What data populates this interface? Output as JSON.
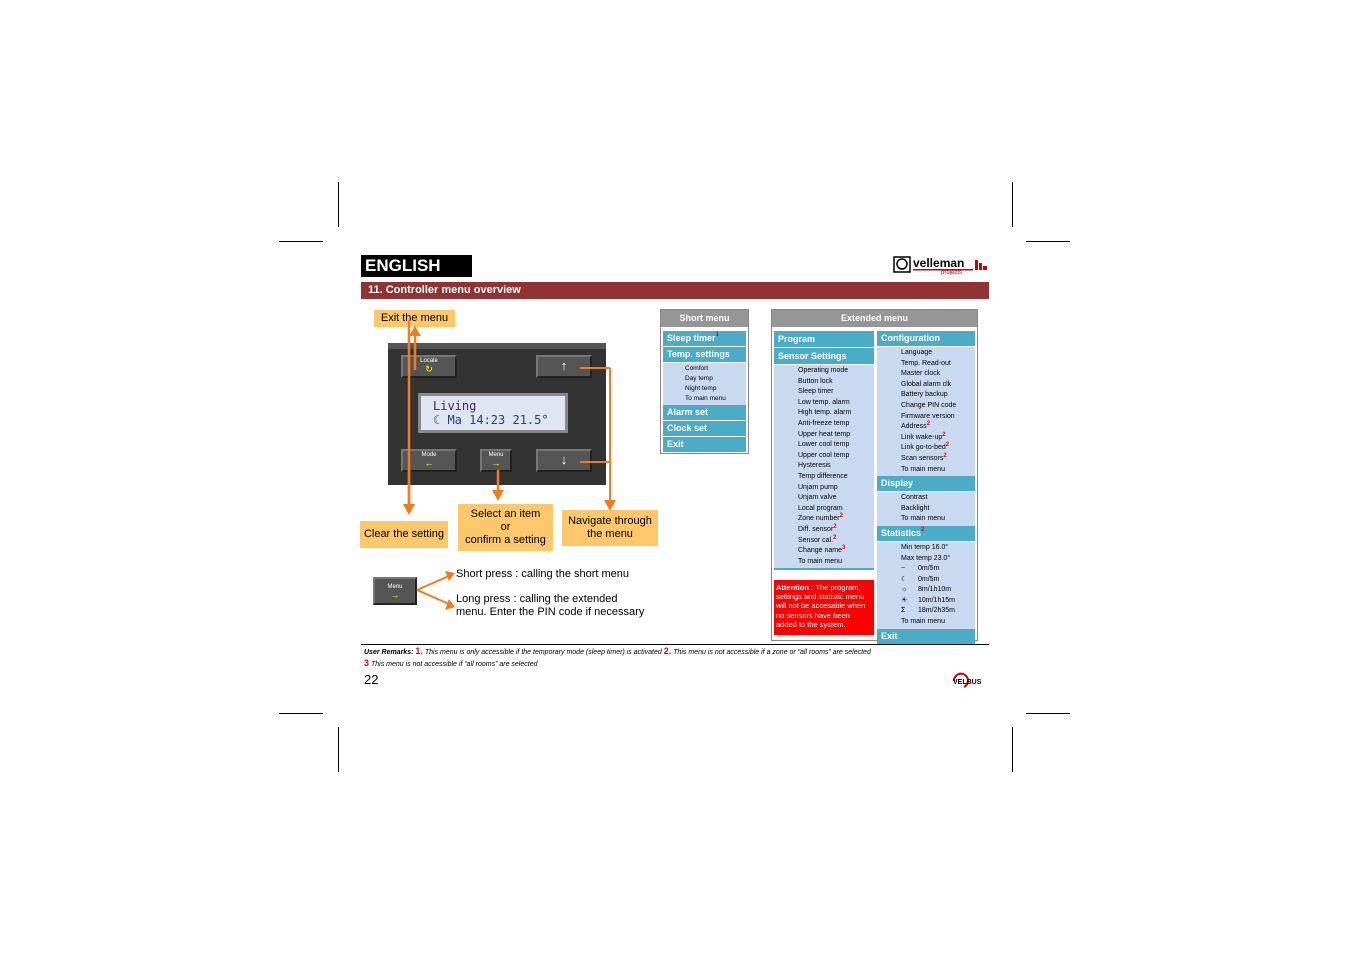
{
  "header": {
    "language": "ENGLISH",
    "logo_text": "velleman projects",
    "section_title": "11. Controller menu overview"
  },
  "device": {
    "buttons": {
      "locale": {
        "label": "Locale",
        "glyph": "↻"
      },
      "up": {
        "glyph": "↑"
      },
      "mode": {
        "label": "Mode",
        "glyph": "←"
      },
      "menu": {
        "label": "Menu",
        "glyph": "→"
      },
      "down": {
        "glyph": "↓"
      }
    },
    "lcd": {
      "line1": "Living",
      "line2": "☾  Ma 14:23 21.5°"
    }
  },
  "callouts": {
    "exit": "Exit the menu",
    "clear": "Clear the setting",
    "select_line1": "Select an item",
    "select_line2": "or",
    "select_line3": "confirm a setting",
    "navigate_line1": "Navigate through",
    "navigate_line2": "the menu"
  },
  "menu_press": {
    "button_label": "Menu",
    "button_glyph": "→",
    "short_press": "Short press : calling the short menu",
    "long_press_line1": "Long press : calling the extended",
    "long_press_line2": "menu. Enter the PIN code if necessary"
  },
  "short_menu": {
    "title": "Short menu",
    "items": [
      {
        "label": "Sleep timer",
        "note": "1"
      },
      {
        "label": "Temp. settings",
        "sub": [
          "Comfort",
          "Day temp",
          "Night temp",
          "To main menu"
        ]
      },
      {
        "label": "Alarm set"
      },
      {
        "label": "Clock set"
      },
      {
        "label": "Exit"
      }
    ]
  },
  "extended_menu": {
    "title": "Extended menu",
    "program": "Program",
    "sensor_settings": {
      "label": "Sensor Settings",
      "items": [
        {
          "label": "Operating mode"
        },
        {
          "label": "Button lock"
        },
        {
          "label": "Sleep timer"
        },
        {
          "label": "Low temp. alarm"
        },
        {
          "label": "High temp. alarm"
        },
        {
          "label": "Anti-freeze temp"
        },
        {
          "label": "Upper heat temp"
        },
        {
          "label": "Lower cool temp"
        },
        {
          "label": "Upper cool temp"
        },
        {
          "label": "Hysteresis"
        },
        {
          "label": "Temp difference"
        },
        {
          "label": "Unjam pump"
        },
        {
          "label": "Unjam valve"
        },
        {
          "label": "Local program"
        },
        {
          "label": "Zone number",
          "note": "2"
        },
        {
          "label": "Diff. sensor",
          "note": "2"
        },
        {
          "label": "Sensor cal.",
          "note": "2"
        },
        {
          "label": "Change name",
          "note": "3"
        },
        {
          "label": "To main menu"
        }
      ]
    },
    "attention_label": "Attention :",
    "attention_text": "The program, settings and statistic menu will not be accesable when no sensors have been added to the system.",
    "configuration": {
      "label": "Configuration",
      "items": [
        {
          "label": "Language"
        },
        {
          "label": "Temp. Read-out"
        },
        {
          "label": "Master clock"
        },
        {
          "label": "Global alarm clk"
        },
        {
          "label": "Battery backup"
        },
        {
          "label": "Change PIN code"
        },
        {
          "label": "Firmware version"
        },
        {
          "label": "Address",
          "note": "2"
        },
        {
          "label": "Link wake-up",
          "note": "2"
        },
        {
          "label": "Link go-to-bed",
          "note": "2"
        },
        {
          "label": "Scan sensors",
          "note": "2"
        },
        {
          "label": "To main menu"
        }
      ]
    },
    "display": {
      "label": "Display",
      "items": [
        {
          "label": "Contrast"
        },
        {
          "label": "Backlight"
        },
        {
          "label": "To main menu"
        }
      ]
    },
    "statistics": {
      "label": "Statistics",
      "note": "2",
      "items": [
        {
          "label": "Min temp 16.0°"
        },
        {
          "label": "Max temp 23.0°"
        },
        {
          "icon": "−",
          "label": "0m/5m"
        },
        {
          "icon": "☾",
          "label": "0m/5m"
        },
        {
          "icon": "☼",
          "label": "8m/1h10m"
        },
        {
          "icon": "☀",
          "label": "10m/1h15m"
        },
        {
          "icon": "Σ",
          "label": "18m/2h35m"
        },
        {
          "label": "To main menu"
        }
      ]
    },
    "exit": "Exit"
  },
  "footer": {
    "remarks_label": "User Remarks:",
    "remark1_num": "1.",
    "remark1": "This menu is only accessible if the temporary mode (sleep timer) is activated",
    "remark2_num": "2.",
    "remark2": "This menu is not accessible if a zone or “all rooms” are selected",
    "remark3_num": "3",
    "remark3": "This menu is not accessible if “all rooms” are selected",
    "page_number": "22",
    "brand": "VELBUS"
  }
}
